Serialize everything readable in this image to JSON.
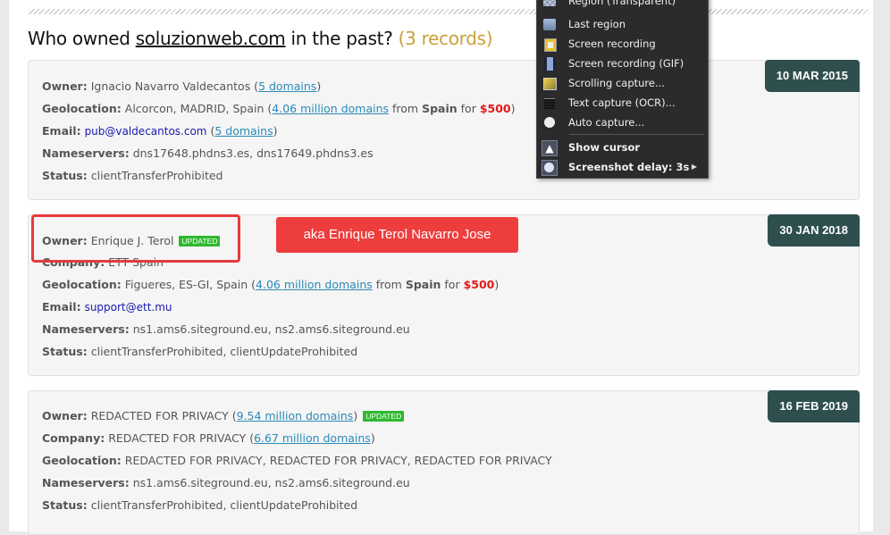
{
  "heading": {
    "prefix": "Who owned ",
    "domain": "soluzionweb.com",
    "suffix": " in the past? ",
    "count": "(3 records)"
  },
  "records": [
    {
      "date": "10 MAR 2015",
      "owner_label": "Owner:",
      "owner": "Ignacio Navarro Valdecantos",
      "owner_link": "5 domains",
      "geo_label": "Geolocation:",
      "geo": "Alcorcon, MADRID, Spain",
      "geo_link": "4.06 million domains",
      "geo_from": "from",
      "geo_country": "Spain",
      "geo_for": "for",
      "geo_price": "$500",
      "email_label": "Email:",
      "email": "pub@valdecantos.com",
      "email_link": "5 domains",
      "ns_label": "Nameservers:",
      "ns": "dns17648.phdns3.es, dns17649.phdns3.es",
      "status_label": "Status:",
      "status": "clientTransferProhibited"
    },
    {
      "date": "30 JAN 2018",
      "owner_label": "Owner:",
      "owner": "Enrique J. Terol",
      "badge": "UPDATED",
      "company_label": "Company:",
      "company": "ETT Spain",
      "geo_label": "Geolocation:",
      "geo": "Figueres, ES-GI, Spain",
      "geo_link": "4.06 million domains",
      "geo_from": "from",
      "geo_country": "Spain",
      "geo_for": "for",
      "geo_price": "$500",
      "email_label": "Email:",
      "email": "support@ett.mu",
      "ns_label": "Nameservers:",
      "ns": "ns1.ams6.siteground.eu, ns2.ams6.siteground.eu",
      "status_label": "Status:",
      "status": "clientTransferProhibited, clientUpdateProhibited"
    },
    {
      "date": "16 FEB 2019",
      "owner_label": "Owner:",
      "owner": "REDACTED FOR PRIVACY",
      "owner_link": "9.54 million domains",
      "badge": "UPDATED",
      "company_label": "Company:",
      "company": "REDACTED FOR PRIVACY",
      "company_link": "6.67 million domains",
      "geo_label": "Geolocation:",
      "geo": "REDACTED FOR PRIVACY, REDACTED FOR PRIVACY, REDACTED FOR PRIVACY",
      "ns_label": "Nameservers:",
      "ns": "ns1.ams6.siteground.eu, ns2.ams6.siteground.eu",
      "status_label": "Status:",
      "status": "clientTransferProhibited, clientUpdateProhibited"
    }
  ],
  "annotation": {
    "aka": "aka Enrique Terol Navarro Jose",
    "highlight_color": "#e53b3b"
  },
  "context_menu": {
    "items": [
      {
        "label": "Region (Transparent)",
        "icon": "region-transparent-icon"
      },
      {
        "label": "Last region",
        "icon": "last-region-icon"
      },
      {
        "label": "Screen recording",
        "icon": "screen-recording-icon"
      },
      {
        "label": "Screen recording (GIF)",
        "icon": "film-strip-icon"
      },
      {
        "label": "Scrolling capture...",
        "icon": "scrolling-capture-icon"
      },
      {
        "label": "Text capture (OCR)...",
        "icon": "text-lines-icon"
      },
      {
        "label": "Auto capture...",
        "icon": "clock-icon"
      },
      {
        "label": "Show cursor",
        "icon": "cursor-icon",
        "checked": true
      },
      {
        "label": "Screenshot delay: 3s",
        "icon": "delay-clock-icon",
        "checked": true,
        "submenu": true
      }
    ]
  },
  "colors": {
    "date_badge": "#2f4f4f",
    "updated_badge": "#2eb82e",
    "price": "#e21b1b",
    "count": "#c9a13b",
    "link": "#2a8ab8"
  }
}
